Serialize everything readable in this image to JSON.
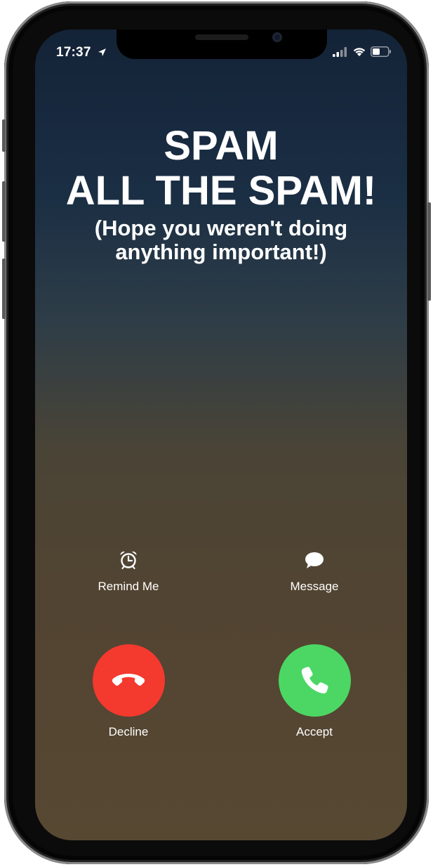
{
  "status_bar": {
    "time": "17:37",
    "location_icon": "location-arrow-icon",
    "signal_icon": "cellular-signal-icon",
    "wifi_icon": "wifi-icon",
    "battery_icon": "battery-icon"
  },
  "caller": {
    "line1": "SPAM",
    "line2": "ALL THE SPAM!",
    "subtitle_line1": "(Hope you weren't doing",
    "subtitle_line2": "anything important!)"
  },
  "actions": {
    "remind_me": {
      "label": "Remind Me",
      "icon": "alarm-clock-icon"
    },
    "message": {
      "label": "Message",
      "icon": "message-bubble-icon"
    }
  },
  "call_buttons": {
    "decline": {
      "label": "Decline",
      "icon": "hang-up-phone-icon",
      "color": "#f4392f"
    },
    "accept": {
      "label": "Accept",
      "icon": "phone-icon",
      "color": "#4cd764"
    }
  }
}
